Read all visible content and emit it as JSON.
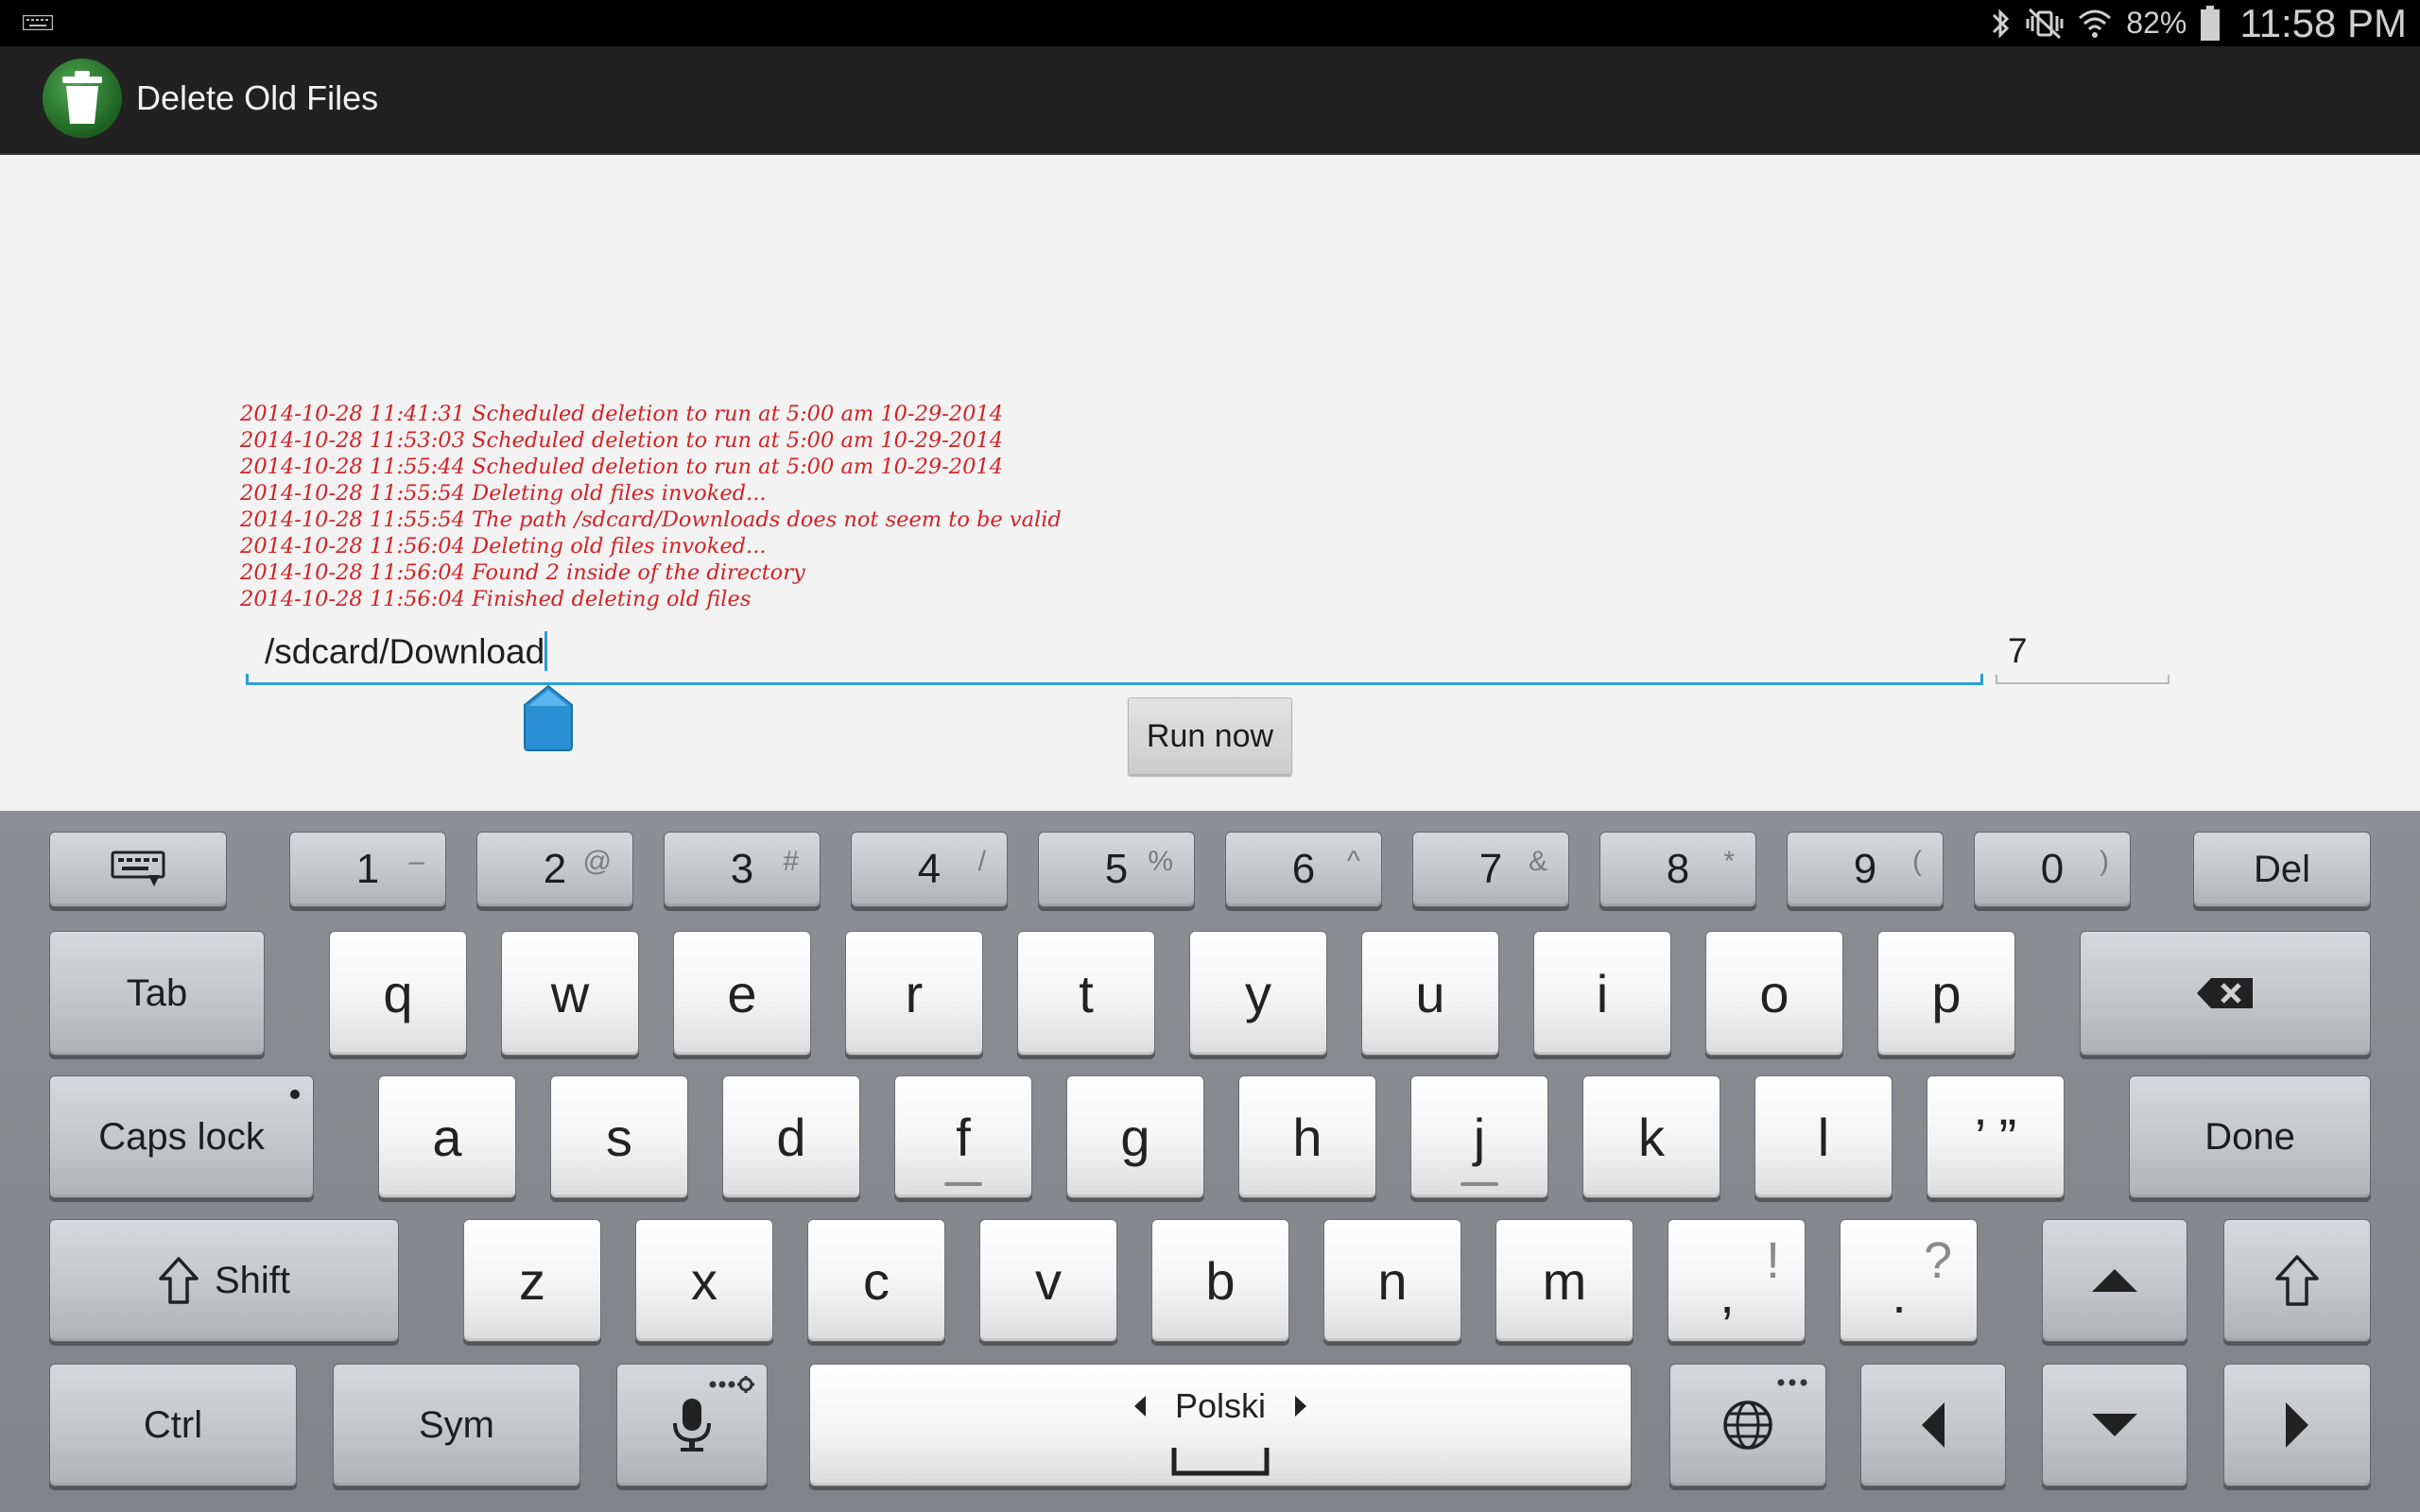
{
  "status_bar": {
    "battery_percent": "82%",
    "time": "11:58 PM",
    "icons": [
      "keyboard-indicator-icon",
      "bluetooth-icon",
      "silent-mode-icon",
      "wifi-icon",
      "battery-icon"
    ]
  },
  "action_bar": {
    "title": "Delete Old Files",
    "app_icon": "trash-can-icon"
  },
  "log_lines": [
    "2014-10-28 11:41:31 Scheduled deletion to run at 5:00 am 10-29-2014",
    "2014-10-28 11:53:03 Scheduled deletion to run at 5:00 am 10-29-2014",
    "2014-10-28 11:55:44 Scheduled deletion to run at 5:00 am 10-29-2014",
    "2014-10-28 11:55:54 Deleting old files invoked...",
    "2014-10-28 11:55:54 The path /sdcard/Downloads does not seem to be valid",
    "2014-10-28 11:56:04 Deleting old files invoked...",
    "2014-10-28 11:56:04 Found 2 inside of the directory",
    "2014-10-28 11:56:04 Finished deleting old files"
  ],
  "form": {
    "path_value": "/sdcard/Download",
    "days_value": "7",
    "run_button": "Run now"
  },
  "colors": {
    "log_text": "#d32226",
    "focus_underline": "#2aa0d8",
    "action_bar": "#212121"
  },
  "keyboard": {
    "language": "Polski",
    "number_row": [
      {
        "main": "1",
        "sub": "–"
      },
      {
        "main": "2",
        "sub": "@"
      },
      {
        "main": "3",
        "sub": "#"
      },
      {
        "main": "4",
        "sub": "/"
      },
      {
        "main": "5",
        "sub": "%"
      },
      {
        "main": "6",
        "sub": "^"
      },
      {
        "main": "7",
        "sub": "&"
      },
      {
        "main": "8",
        "sub": "*"
      },
      {
        "main": "9",
        "sub": "("
      },
      {
        "main": "0",
        "sub": ")"
      }
    ],
    "row1": [
      "q",
      "w",
      "e",
      "r",
      "t",
      "y",
      "u",
      "i",
      "o",
      "p"
    ],
    "row2": [
      "a",
      "s",
      "d",
      "f",
      "g",
      "h",
      "j",
      "k",
      "l",
      "’ ”"
    ],
    "row3": [
      {
        "main": "z"
      },
      {
        "main": "x"
      },
      {
        "main": "c"
      },
      {
        "main": "v"
      },
      {
        "main": "b"
      },
      {
        "main": "n"
      },
      {
        "main": "m"
      },
      {
        "main": ",",
        "sub": "!"
      },
      {
        "main": ".",
        "sub": "?"
      }
    ],
    "labels": {
      "del": "Del",
      "tab": "Tab",
      "caps": "Caps lock",
      "done": "Done",
      "shift": "Shift",
      "ctrl": "Ctrl",
      "sym": "Sym"
    }
  }
}
